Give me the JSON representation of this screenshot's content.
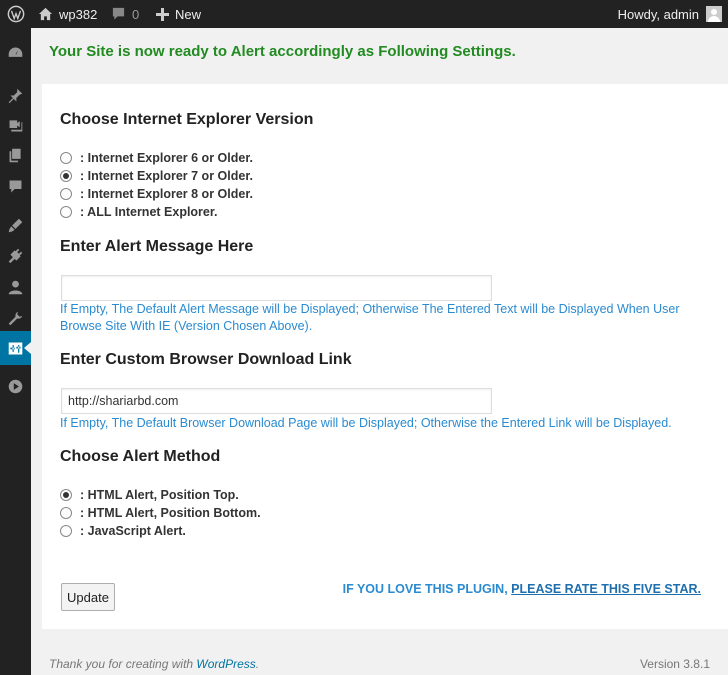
{
  "adminbar": {
    "site_name": "wp382",
    "comments_count": "0",
    "new_label": "New",
    "howdy": "Howdy, admin"
  },
  "sidebar": {
    "items": [
      {
        "icon": "dashboard-icon"
      },
      {
        "icon": "pin-icon"
      },
      {
        "icon": "media-icon"
      },
      {
        "icon": "pages-icon"
      },
      {
        "icon": "comment-icon"
      },
      {
        "icon": "appearance-icon"
      },
      {
        "icon": "plugins-icon"
      },
      {
        "icon": "users-icon"
      },
      {
        "icon": "tools-icon"
      },
      {
        "icon": "settings-icon",
        "current": true
      },
      {
        "icon": "collapse-icon"
      }
    ]
  },
  "notice": "Your Site is now ready to Alert accordingly as Following Settings.",
  "ie_section": {
    "heading": "Choose Internet Explorer Version",
    "options": [
      {
        "label": ": Internet Explorer 6 or Older.",
        "checked": false
      },
      {
        "label": ": Internet Explorer 7 or Older.",
        "checked": true
      },
      {
        "label": ": Internet Explorer 8 or Older.",
        "checked": false
      },
      {
        "label": ": ALL Internet Explorer.",
        "checked": false
      }
    ]
  },
  "message_section": {
    "heading": "Enter Alert Message Here",
    "value": "",
    "help": "If Empty, The Default Alert Message will be Displayed; Otherwise The Entered Text will be Displayed When User Browse Site With IE (Version Chosen Above)."
  },
  "link_section": {
    "heading": "Enter Custom Browser Download Link",
    "value": "http://shariarbd.com",
    "help": "If Empty, The Default Browser Download Page will be Displayed; Otherwise the Entered Link will be Displayed."
  },
  "method_section": {
    "heading": "Choose Alert Method",
    "options": [
      {
        "label": ": HTML Alert, Position Top.",
        "checked": true
      },
      {
        "label": ": HTML Alert, Position Bottom.",
        "checked": false
      },
      {
        "label": ": JavaScript Alert.",
        "checked": false
      }
    ]
  },
  "update_label": "Update",
  "rate": {
    "prefix": "IF YOU LOVE THIS PLUGIN, ",
    "link": "PLEASE RATE THIS FIVE STAR."
  },
  "footer": {
    "thanks": "Thank you for creating with ",
    "wp_link": "WordPress",
    "period": ".",
    "version": "Version 3.8.1"
  }
}
